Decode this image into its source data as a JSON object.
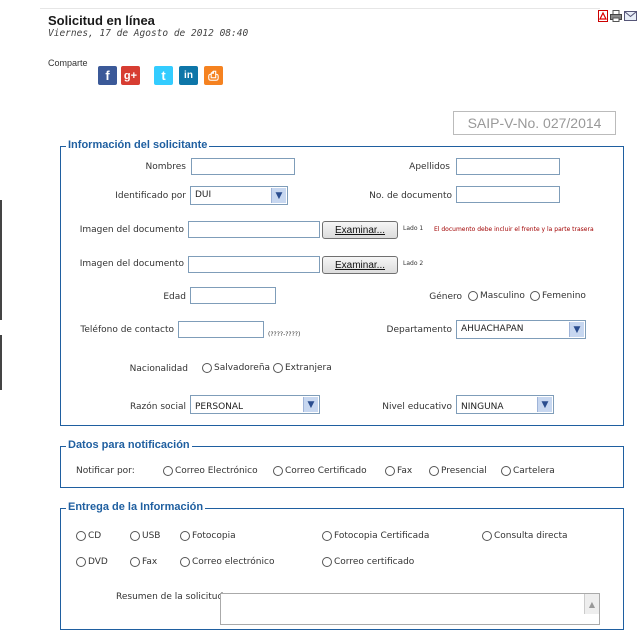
{
  "header": {
    "title": "Solicitud en línea",
    "date": "Viernes, 17 de Agosto de 2012 08:40",
    "share_label": "Comparte"
  },
  "icons": [
    "pdf-icon",
    "print-icon",
    "email-icon",
    "facebook-icon",
    "googleplus-icon",
    "twitter-icon",
    "linkedin-icon",
    "print-share-icon"
  ],
  "share_buttons": {
    "facebook": "f",
    "googleplus": "g+",
    "twitter": "t",
    "linkedin": "in",
    "print": "⎙"
  },
  "colors": {
    "accent": "#1f5fa0",
    "facebook": "#3b5998",
    "googleplus": "#d73d32",
    "twitter": "#33ccff",
    "linkedin": "#0e76a8",
    "print": "#f58220",
    "note": "#a10000"
  },
  "reference": "SAIP-V-No. 027/2014",
  "solicitante": {
    "legend": "Información del solicitante",
    "nombres_label": "Nombres",
    "apellidos_label": "Apellidos",
    "identificado_label": "Identificado por",
    "identificado_value": "DUI",
    "nodoc_label": "No. de documento",
    "imagen1_label": "Imagen del documento",
    "imagen2_label": "Imagen del documento",
    "examinar": "Examinar...",
    "lado1": "Lado 1",
    "lado2": "Lado 2",
    "doc_note": "El documento debe incluir el frente y la parte trasera",
    "edad_label": "Edad",
    "genero_label": "Género",
    "genero_options": [
      "Masculino",
      "Femenino"
    ],
    "telefono_label": "Teléfono de contacto",
    "telefono_hint": "(????-????)",
    "departamento_label": "Departamento",
    "departamento_value": "AHUACHAPAN",
    "nacionalidad_label": "Nacionalidad",
    "nacionalidad_options": [
      "Salvadoreña",
      "Extranjera"
    ],
    "razon_label": "Razón social",
    "razon_value": "PERSONAL",
    "nivel_label": "Nivel educativo",
    "nivel_value": "NINGUNA"
  },
  "notificacion": {
    "legend": "Datos para notificación",
    "label": "Notificar por:",
    "options": [
      "Correo Electrónico",
      "Correo Certificado",
      "Fax",
      "Presencial",
      "Cartelera"
    ]
  },
  "entrega": {
    "legend": "Entrega de la Información",
    "row1": [
      "CD",
      "USB",
      "Fotocopia",
      "Fotocopia Certificada",
      "Consulta directa"
    ],
    "row2": [
      "DVD",
      "Fax",
      "Correo electrónico",
      "Correo certificado"
    ],
    "resumen_label": "Resumen de la solicitud"
  }
}
